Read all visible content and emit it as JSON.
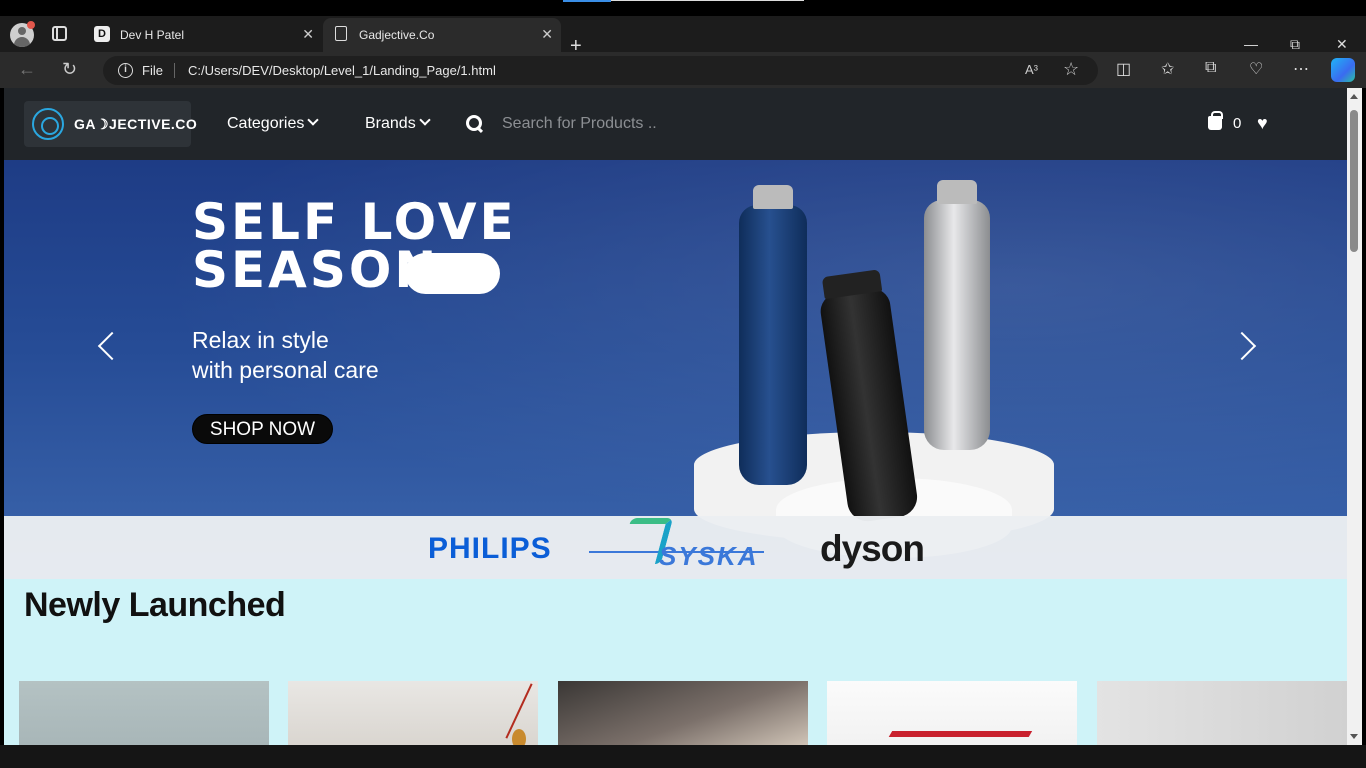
{
  "browser": {
    "tabs": [
      {
        "title": "Dev H Patel",
        "favicon": "D"
      },
      {
        "title": "Gadjective.Co"
      }
    ],
    "address": {
      "scheme_label": "File",
      "url": "C:/Users/DEV/Desktop/Level_1/Landing_Page/1.html",
      "read_aloud": "A³"
    },
    "window_controls": {
      "minimize": "—",
      "restore": "⧉",
      "close": "✕"
    },
    "icons": [
      "back-icon",
      "refresh-icon",
      "split-screen-icon",
      "favorites-icon",
      "collections-icon",
      "performance-icon",
      "more-icon",
      "copilot-icon"
    ]
  },
  "site": {
    "logo_text": "GA☽JECTIVE.CO",
    "nav": {
      "categories": "Categories",
      "brands": "Brands"
    },
    "search": {
      "placeholder": "Search for Products .."
    },
    "cart_count": "0"
  },
  "banner": {
    "headline_line1": "SELF LOVE",
    "headline_line2": "SEASON",
    "subline_line1": "Relax in style",
    "subline_line2": "with personal care",
    "cta": "SHOP NOW",
    "brands": [
      "PHILIPS",
      "SYSKA",
      "dyson"
    ],
    "colors": {
      "background": "#264c96",
      "philips": "#0b5ed7",
      "syska": "#3b78d9"
    }
  },
  "sections": {
    "newly_launched": "Newly Launched"
  }
}
